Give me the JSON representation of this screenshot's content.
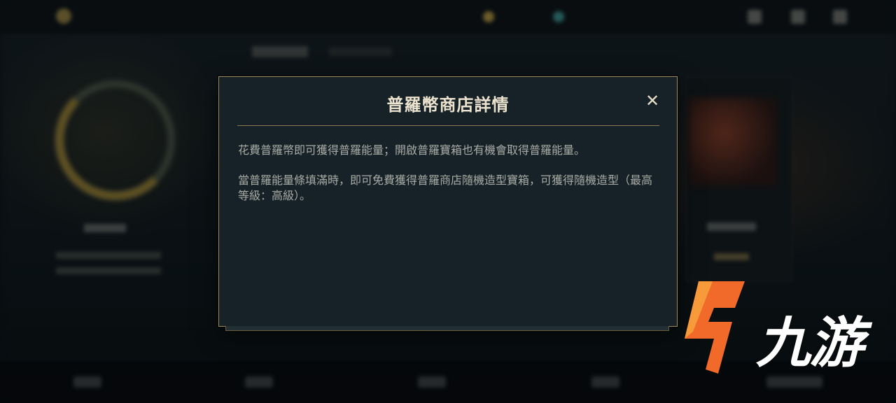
{
  "modal": {
    "title": "普羅幣商店詳情",
    "close_label": "✕",
    "paragraphs": [
      "花費普羅幣即可獲得普羅能量；開啟普羅寶箱也有機會取得普羅能量。",
      "當普羅能量條填滿時，即可免費獲得普羅商店隨機造型寶箱，可獲得隨機造型（最高等級：高級）。"
    ]
  },
  "watermark": {
    "text": "九游"
  },
  "colors": {
    "modal_bg": "#172228",
    "modal_border": "#a08a55",
    "title_text": "#ece3cf",
    "body_text": "#a8aca5",
    "logo_orange": "#f26a2a"
  }
}
